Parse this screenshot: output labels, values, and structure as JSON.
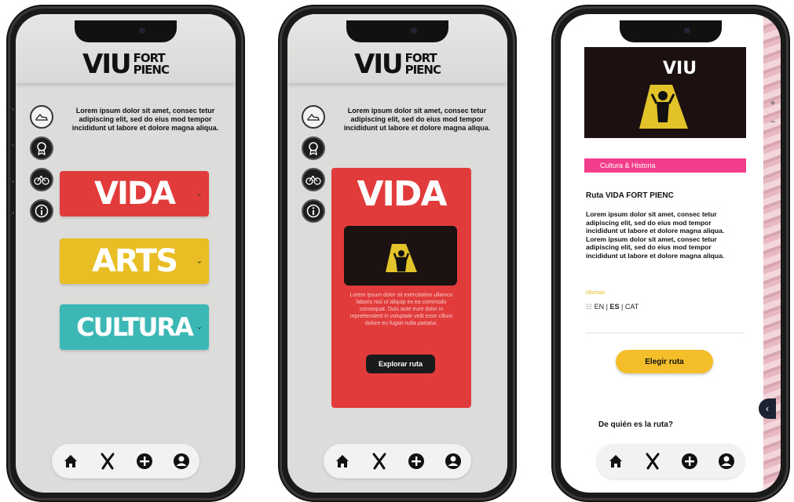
{
  "app": {
    "logo_big": "VIU",
    "logo_line1": "FORT",
    "logo_line2": "PIENC"
  },
  "intro_text": "Lorem ipsum dolor sit amet, consec tetur adipiscing elit, sed do eius mod tempor incididunt ut labore et dolore magna aliqua.",
  "side_icons": [
    "shoe-icon",
    "medal-icon",
    "bicycle-icon",
    "info-icon"
  ],
  "categories": [
    {
      "label": "VIDA",
      "color": "#e23b3b"
    },
    {
      "label": "ARTS",
      "color": "#e9be25"
    },
    {
      "label": "CULTURA",
      "color": "#3bb7b5"
    }
  ],
  "card": {
    "title": "VIDA",
    "description": "Lorem ipsum dolor sit exercitation ullamco laboris nisi ut aliquip ex ea commodo consequat. Duis aute irure dolor in reprehenderit in voluptate velit esse cillum dolore eu fugiat nulla pariatur.",
    "explore_label": "Explorar ruta"
  },
  "detail": {
    "tag": "Cultura & Historia",
    "title": "Ruta VIDA FORT PIENC",
    "description": "Lorem ipsum dolor sit amet, consec tetur adipiscing elit, sed do eius mod tempor incididunt ut labore et dolore magna aliqua. Lorem ipsum dolor sit amet, consec tetur adipiscing elit, sed do eius mod tempor incididunt ut labore et dolore magna aliqua.",
    "lang_label": "Idiomas",
    "languages": {
      "en": "EN",
      "es": "ES",
      "cat": "CAT",
      "sep": "|"
    },
    "choose_label": "Elegir ruta",
    "whose_label": "De quién es la ruta?"
  },
  "nav": [
    "home-icon",
    "map-icon",
    "add-icon",
    "profile-icon"
  ],
  "colors": {
    "accent_pink": "#f23d8a",
    "accent_yellow": "#f3be2a",
    "red": "#e23b3b",
    "teal": "#3bb7b5"
  }
}
